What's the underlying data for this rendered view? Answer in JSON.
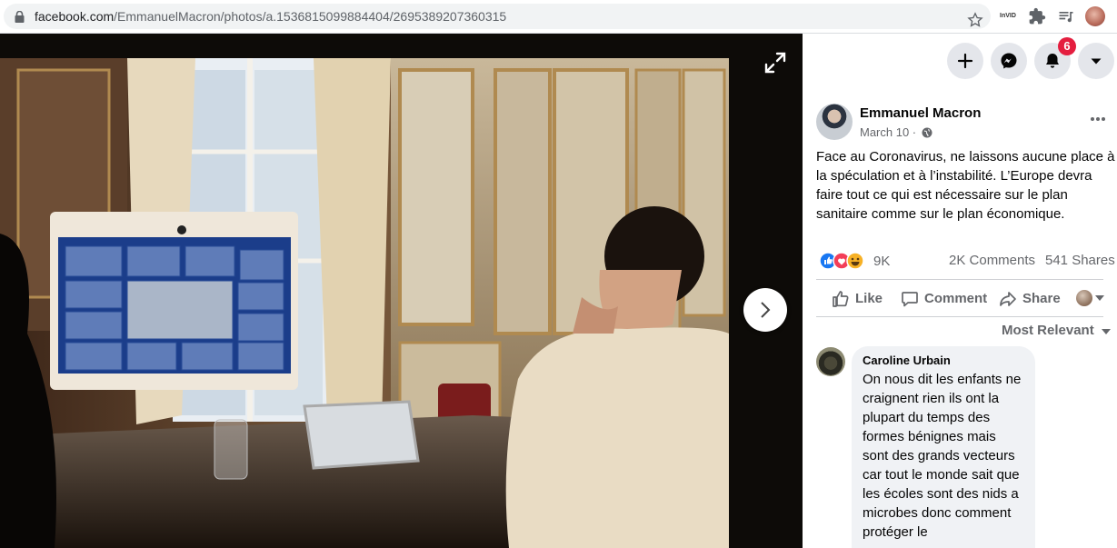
{
  "browser": {
    "url_host": "facebook.com",
    "url_path": "/EmmanuelMacron/photos/a.1536815099884404/2695389207360315",
    "extension_label": "InVID"
  },
  "header": {
    "notification_count": "6"
  },
  "post": {
    "author": "Emmanuel Macron",
    "date": "March 10 ·",
    "text": "Face au Coronavirus, ne laissons aucune place à la spéculation et à l’instabilité. L’Europe devra faire tout ce qui est nécessaire sur le plan sanitaire comme sur le plan économique.",
    "reaction_count": "9K",
    "comments_count": "2K Comments",
    "shares_count": "541 Shares"
  },
  "actions": {
    "like": "Like",
    "comment": "Comment",
    "share": "Share"
  },
  "comments": {
    "sort_label": "Most Relevant",
    "items": [
      {
        "author": "Caroline Urbain",
        "text": "On nous dit les enfants ne craignent rien ils ont la plupart du temps des formes bénignes mais sont des grands vecteurs car tout le monde sait que les écoles sont des nids a microbes donc comment protéger le"
      }
    ]
  },
  "colors": {
    "facebook_blue": "#1877f2",
    "badge_red": "#e41e3f",
    "secondary_text": "#65676b",
    "button_gray": "#e4e6eb",
    "comment_bubble": "#f0f2f5"
  }
}
